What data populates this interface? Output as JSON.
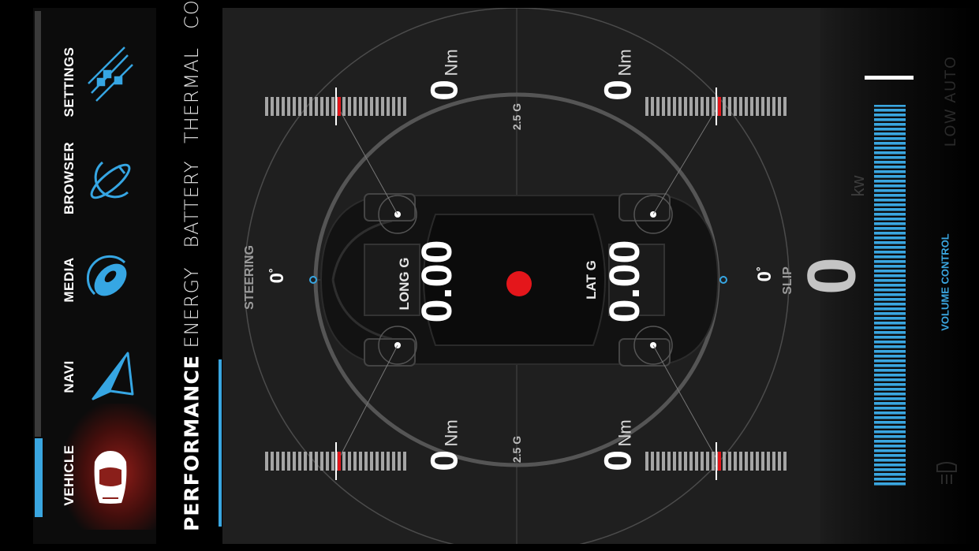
{
  "nav": {
    "items": [
      {
        "label": "VEHICLE",
        "icon": "car-icon",
        "active": true
      },
      {
        "label": "NAVI",
        "icon": "navigation-arrow-icon"
      },
      {
        "label": "MEDIA",
        "icon": "media-disc-icon"
      },
      {
        "label": "BROWSER",
        "icon": "globe-orbit-icon"
      },
      {
        "label": "SETTINGS",
        "icon": "sliders-icon"
      }
    ]
  },
  "tabs": [
    {
      "label": "PERFORMANCE",
      "active": true
    },
    {
      "label": "ENERGY"
    },
    {
      "label": "BATTERY"
    },
    {
      "label": "THERMAL"
    },
    {
      "label": "CO"
    }
  ],
  "performance": {
    "torque": {
      "rear_left": {
        "value": "0",
        "unit": "Nm"
      },
      "front_left": {
        "value": "0",
        "unit": "Nm"
      },
      "rear_right": {
        "value": "0",
        "unit": "Nm"
      },
      "front_right": {
        "value": "0",
        "unit": "Nm"
      }
    },
    "g_ring_label_top": "2.5 G",
    "g_ring_label_bottom": "2.5 G",
    "long_g": {
      "label": "LONG G",
      "value": "0.00"
    },
    "lat_g": {
      "label": "LAT G",
      "value": "0.00"
    },
    "steering": {
      "label": "STEERING",
      "value": "0",
      "unit": "°"
    },
    "slip": {
      "label": "SLIP",
      "value": "0",
      "unit": "°"
    },
    "power": {
      "value": "0",
      "unit": "kw"
    }
  },
  "bottom": {
    "volume_control_label": "VOLUME CONTROL",
    "modes": "LOW   AUTO",
    "volume_level": 0.95
  },
  "colors": {
    "accent": "#36a6e3",
    "indicator": "#e4161b",
    "active_nav_glow": "#8a1f1a"
  }
}
